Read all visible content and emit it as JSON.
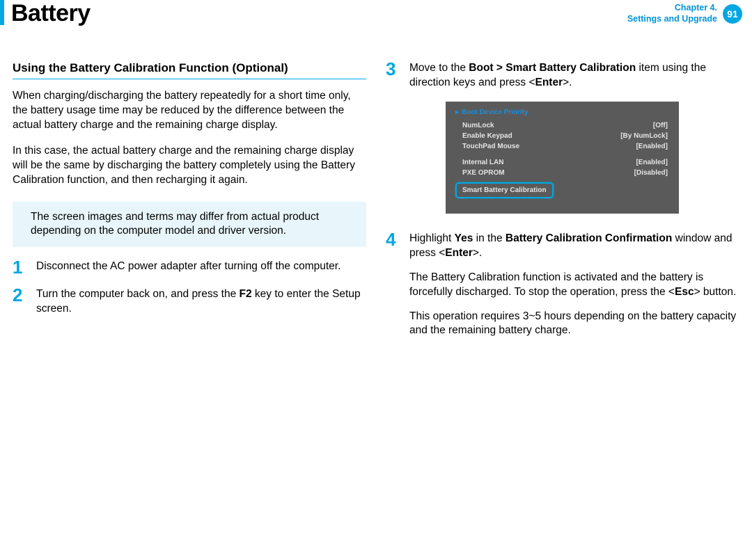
{
  "header": {
    "title": "Battery"
  },
  "chapter": {
    "line1": "Chapter 4.",
    "line2": "Settings and Upgrade",
    "page": "91"
  },
  "left": {
    "subhead": "Using the Battery Calibration Function (Optional)",
    "p1": "When charging/discharging the battery repeatedly for a short time only, the battery usage time may be reduced by the difference between the actual battery charge and the remaining charge display.",
    "p2": "In this case, the actual battery charge and the remaining charge display will be the same by discharging the battery completely using the Battery Calibration function, and then recharging it again.",
    "note": "The screen images and terms may differ from actual product depending on the computer model and driver version.",
    "step1": {
      "num": "1",
      "text": "Disconnect the AC power adapter after turning off the computer."
    },
    "step2": {
      "num": "2",
      "pre": "Turn the computer back on, and press the ",
      "key": "F2",
      "post": " key to enter the Setup screen."
    }
  },
  "right": {
    "step3": {
      "num": "3",
      "pre": "Move to the ",
      "path": "Boot > Smart Battery Calibration",
      "mid": " item using the direction keys and press <",
      "enter": "Enter",
      "post": ">."
    },
    "bios": {
      "header": "Boot Device Priority",
      "rows": [
        {
          "k": "NumLock",
          "v": "[Off]"
        },
        {
          "k": "Enable Keypad",
          "v": "[By NumLock]"
        },
        {
          "k": "TouchPad Mouse",
          "v": "[Enabled]"
        }
      ],
      "rows2": [
        {
          "k": "Internal LAN",
          "v": "[Enabled]"
        },
        {
          "k": "PXE OPROM",
          "v": "[Disabled]"
        }
      ],
      "highlight": "Smart Battery Calibration"
    },
    "step4": {
      "num": "4",
      "line1_pre": "Highlight ",
      "yes": "Yes",
      "line1_mid": " in the ",
      "dialog": "Battery Calibration Confirmation",
      "line1_post1": " window and press <",
      "enter": "Enter",
      "line1_post2": ">.",
      "line2_pre": "The Battery Calibration function is activated and the battery is forcefully discharged. To stop the operation, press the <",
      "esc": "Esc",
      "line2_post": "> button.",
      "line3": "This operation requires 3~5 hours depending on the battery capacity and the remaining battery charge."
    }
  }
}
